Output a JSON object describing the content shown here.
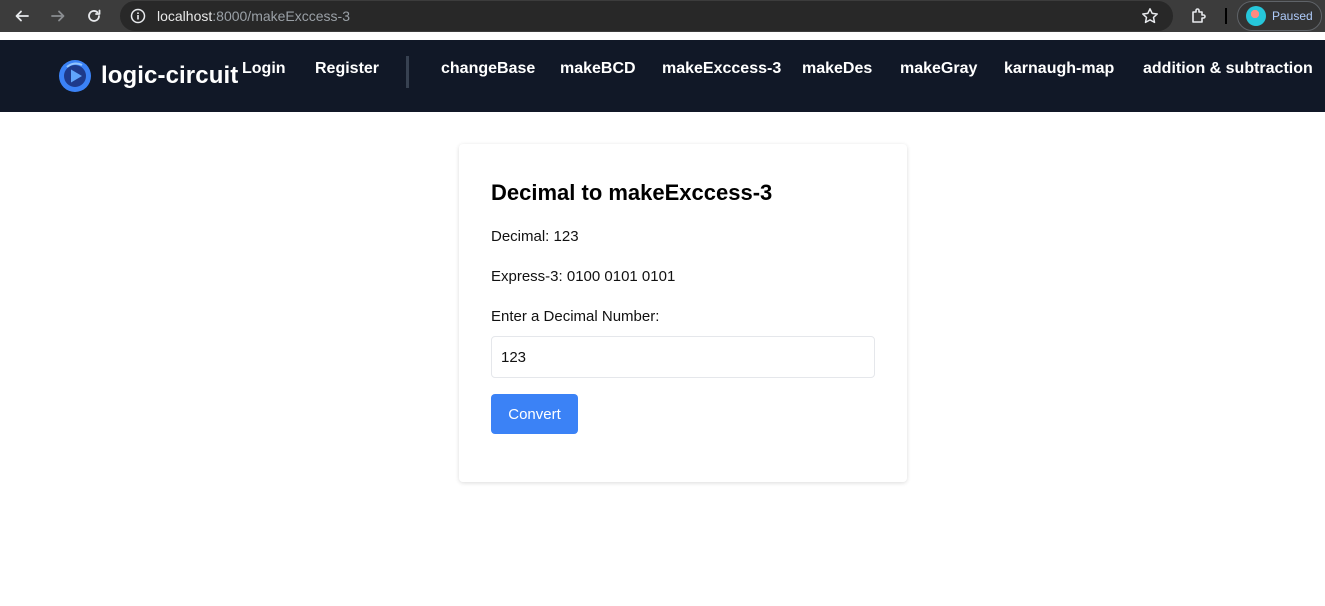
{
  "browser": {
    "url_host": "localhost",
    "url_path": ":8000/makeExccess-3",
    "profile_status": "Paused"
  },
  "header": {
    "brand": "logic-circuit",
    "auth_links": [
      "Login",
      "Register"
    ],
    "nav_links": [
      "changeBase",
      "makeBCD",
      "makeExccess-3",
      "makeDes",
      "makeGray",
      "karnaugh-map",
      "addition & subtraction"
    ]
  },
  "converter": {
    "title": "Decimal to makeExccess-3",
    "decimal_line": "Decimal: 123",
    "result_line": "Express-3: 0100 0101 0101",
    "input_label": "Enter a Decimal Number:",
    "input_value": "123",
    "button_label": "Convert"
  },
  "colors": {
    "header_bg": "#111827",
    "button_bg": "#3b82f6",
    "brand_logo": "#3b82f6"
  }
}
